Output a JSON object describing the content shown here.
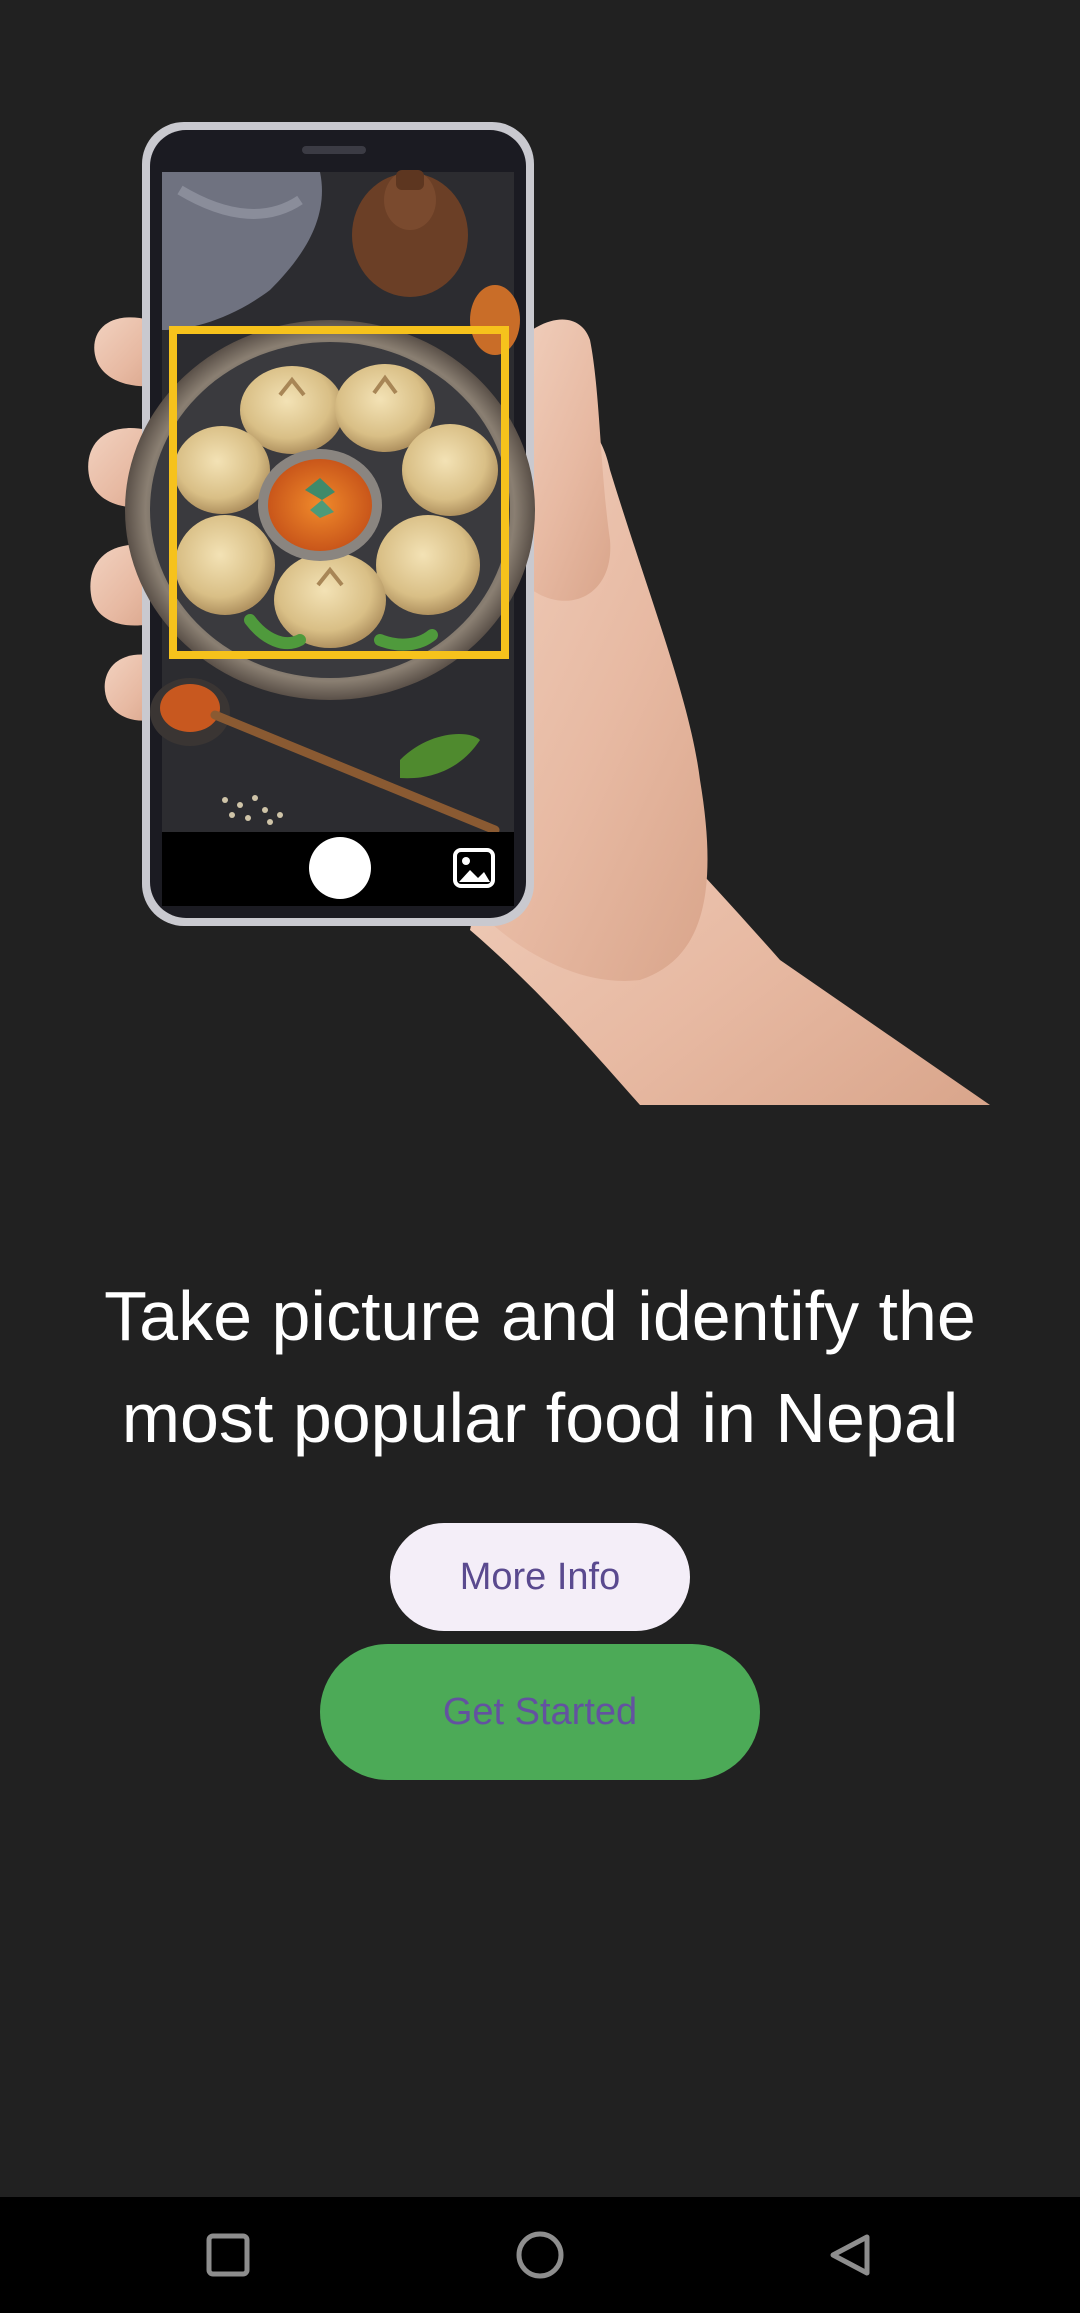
{
  "onboarding": {
    "headline_line1": "Take picture and identify the",
    "headline_line2": "most popular food in Nepal",
    "more_info_label": "More Info",
    "get_started_label": "Get Started"
  },
  "colors": {
    "background": "#212121",
    "more_info_bg": "#F4EEF8",
    "more_info_text": "#5A4A8F",
    "get_started_bg": "#4CAA57",
    "get_started_text": "#6352A0",
    "detection_box": "#F6C21C",
    "navbar": "#000000"
  },
  "hero": {
    "illustration": "hand-holding-phone-scanning-momos",
    "detection_box_icon": "detection-frame",
    "camera_controls": [
      "shutter-button",
      "gallery-icon"
    ]
  },
  "system_nav": {
    "icons": [
      "recents-icon",
      "home-icon",
      "back-icon"
    ]
  }
}
